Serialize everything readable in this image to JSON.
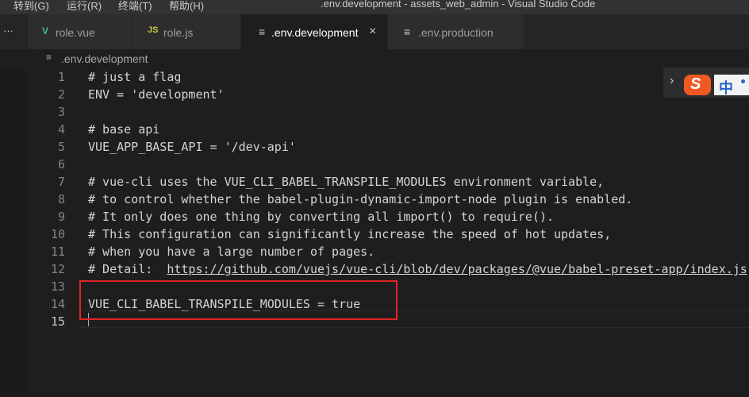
{
  "titlebar": {
    "menus": [
      "转到(G)",
      "运行(R)",
      "终端(T)",
      "帮助(H)"
    ],
    "window_title": ".env.development - assets_web_admin - Visual Studio Code"
  },
  "tabs": [
    {
      "label": "role.vue",
      "icon": "V",
      "icon_color": "#41b883",
      "active": false
    },
    {
      "label": "role.js",
      "icon": "JS",
      "icon_color": "#cbcb41",
      "active": false
    },
    {
      "label": ".env.development",
      "icon": "≡",
      "icon_color": "#cccccc",
      "active": true,
      "close": "×"
    },
    {
      "label": ".env.production",
      "icon": "≡",
      "icon_color": "#cccccc",
      "active": false
    }
  ],
  "breadcrumb": {
    "icon": "≡",
    "label": ".env.development"
  },
  "editor": {
    "line_numbers": [
      "1",
      "2",
      "3",
      "4",
      "5",
      "6",
      "7",
      "8",
      "9",
      "10",
      "11",
      "12",
      "13",
      "14",
      "15"
    ],
    "lines": [
      "# just a flag",
      "ENV = 'development'",
      "",
      "# base api",
      "VUE_APP_BASE_API = '/dev-api'",
      "",
      "# vue-cli uses the VUE_CLI_BABEL_TRANSPILE_MODULES environment variable,",
      "# to control whether the babel-plugin-dynamic-import-node plugin is enabled.",
      "# It only does one thing by converting all import() to require().",
      "# This configuration can significantly increase the speed of hot updates,",
      "# when you have a large number of pages.",
      "# Detail:  ",
      "",
      "VUE_CLI_BABEL_TRANSPILE_MODULES = true",
      ""
    ],
    "detail_url": "https://github.com/vuejs/vue-cli/blob/dev/packages/@vue/babel-preset-app/index.js"
  },
  "ime": {
    "logo_letter": "S",
    "mode": "中"
  },
  "colors": {
    "highlight_box": "#e02424",
    "editor_bg": "#1e1e1e",
    "text": "#d4d4d4"
  }
}
